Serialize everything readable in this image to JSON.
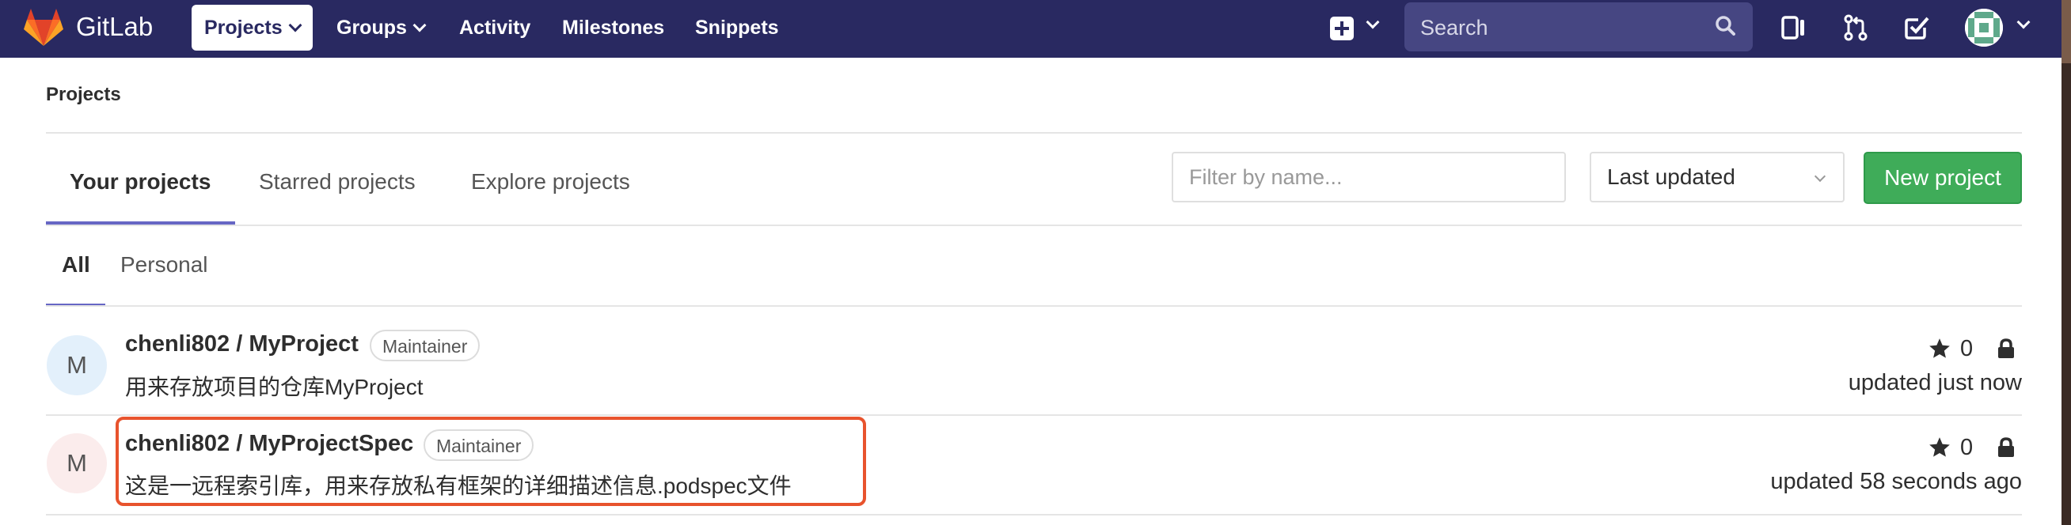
{
  "navbar": {
    "brand": "GitLab",
    "items": [
      {
        "label": "Projects",
        "has_caret": true,
        "active": true
      },
      {
        "label": "Groups",
        "has_caret": true
      },
      {
        "label": "Activity"
      },
      {
        "label": "Milestones"
      },
      {
        "label": "Snippets"
      }
    ],
    "search_placeholder": "Search",
    "icons": [
      "plus-square-icon",
      "search-icon",
      "issues-panel-icon",
      "merge-request-icon",
      "todo-check-icon",
      "user-avatar"
    ],
    "background": "#292961"
  },
  "breadcrumb": "Projects",
  "tabs": [
    {
      "label": "Your projects",
      "active": true
    },
    {
      "label": "Starred projects"
    },
    {
      "label": "Explore projects"
    }
  ],
  "filter": {
    "placeholder": "Filter by name..."
  },
  "sort": {
    "selected": "Last updated"
  },
  "new_project_button": {
    "label": "New project",
    "color": "#3fac59"
  },
  "subtabs": [
    {
      "label": "All",
      "active": true
    },
    {
      "label": "Personal"
    }
  ],
  "projects": [
    {
      "avatar_letter": "M",
      "avatar_bg": "#e3f0fb",
      "title": "chenli802 / MyProject",
      "role": "Maintainer",
      "description": "用来存放项目的仓库MyProject",
      "stars": "0",
      "updated": "updated just now",
      "private": true
    },
    {
      "avatar_letter": "M",
      "avatar_bg": "#fbecec",
      "title": "chenli802 / MyProjectSpec",
      "role": "Maintainer",
      "description": "这是一远程索引库，用来存放私有框架的详细描述信息.podspec文件",
      "stars": "0",
      "updated": "updated 58 seconds ago",
      "private": true,
      "highlighted": true,
      "highlight_color": "#e8532d"
    }
  ]
}
